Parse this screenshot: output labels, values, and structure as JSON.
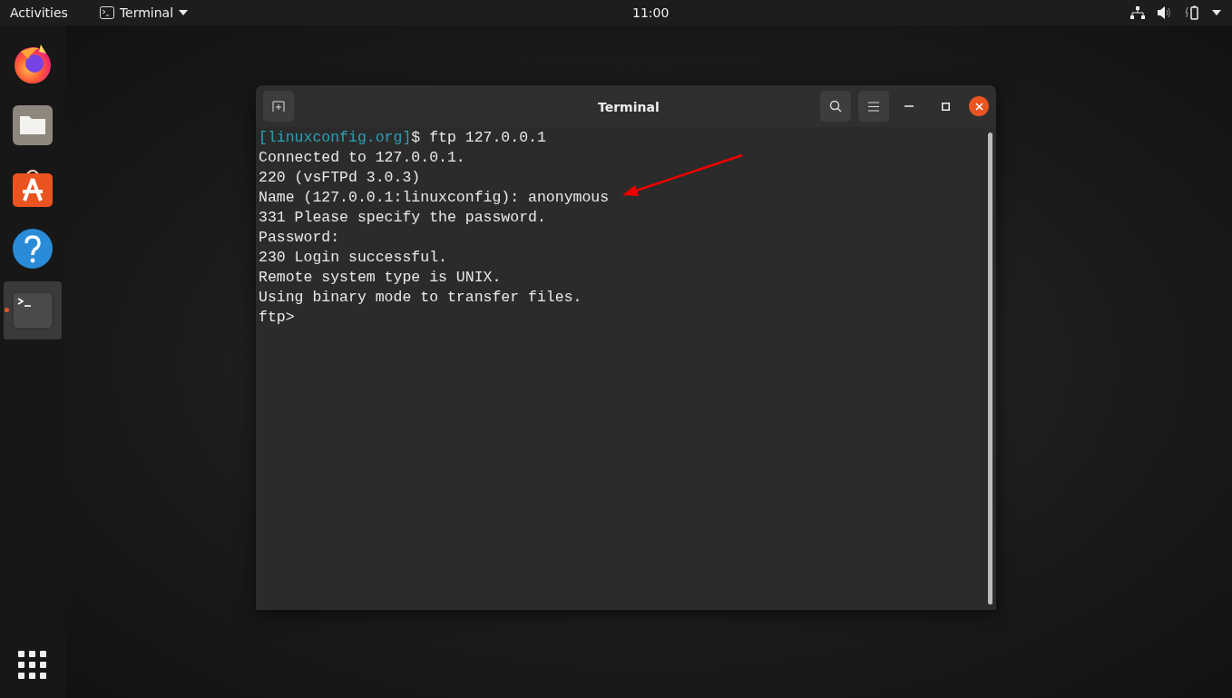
{
  "top_bar": {
    "activities": "Activities",
    "app_menu": "Terminal",
    "clock": "11:00"
  },
  "dock": {
    "items": [
      {
        "kind": "firefox",
        "selected": false,
        "running": false
      },
      {
        "kind": "files",
        "selected": false,
        "running": false
      },
      {
        "kind": "software",
        "selected": false,
        "running": false
      },
      {
        "kind": "help",
        "selected": false,
        "running": false
      },
      {
        "kind": "terminal",
        "selected": true,
        "running": true
      }
    ]
  },
  "window": {
    "title": "Terminal",
    "lines": [
      {
        "prompt": "[linuxconfig.org]",
        "text": "$ ftp 127.0.0.1"
      },
      {
        "text": "Connected to 127.0.0.1."
      },
      {
        "text": "220 (vsFTPd 3.0.3)"
      },
      {
        "text": "Name (127.0.0.1:linuxconfig): anonymous"
      },
      {
        "text": "331 Please specify the password."
      },
      {
        "text": "Password:"
      },
      {
        "text": "230 Login successful."
      },
      {
        "text": "Remote system type is UNIX."
      },
      {
        "text": "Using binary mode to transfer files."
      },
      {
        "text": "ftp>"
      }
    ]
  }
}
